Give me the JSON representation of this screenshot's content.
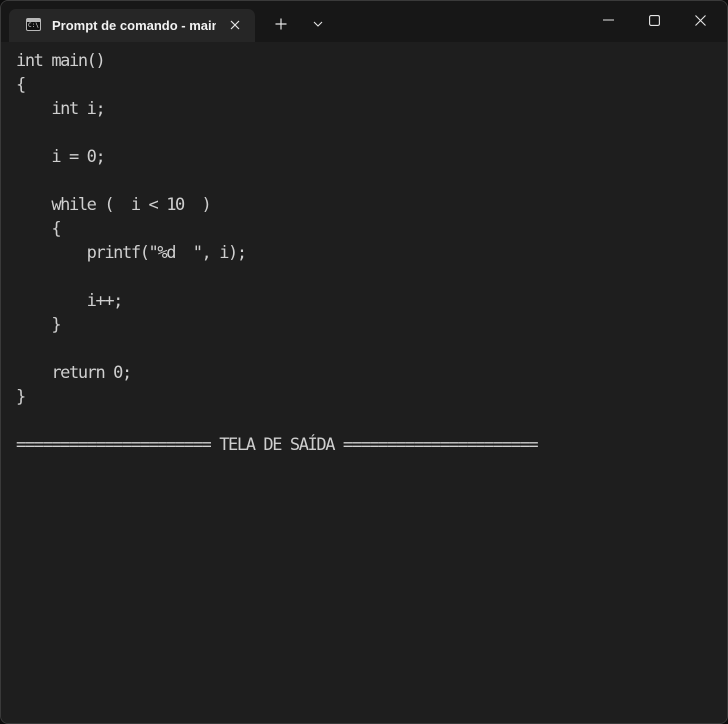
{
  "window": {
    "tab_title": "Prompt de comando - main",
    "tab_icon_text": "C:\\",
    "icons": {
      "tab_icon": "command-prompt-icon",
      "tab_close": "close-icon",
      "new_tab": "plus-icon",
      "dropdown": "chevron-down-icon",
      "minimize": "minimize-icon",
      "maximize": "maximize-icon",
      "close": "close-icon"
    }
  },
  "console": {
    "lines": [
      "int main()",
      "{",
      "    int i;",
      "",
      "    i = 0;",
      "",
      "    while (  i < 10  )",
      "    {",
      "        printf(\"%d  \", i);",
      "",
      "        i++;",
      "    }",
      "",
      "    return 0;",
      "}",
      "",
      "====================== TELA DE SAÍDA ======================"
    ]
  },
  "colors": {
    "background": "#1e1e1e",
    "titlebar": "#171717",
    "tab": "#262626",
    "text": "#cfcfcf"
  }
}
